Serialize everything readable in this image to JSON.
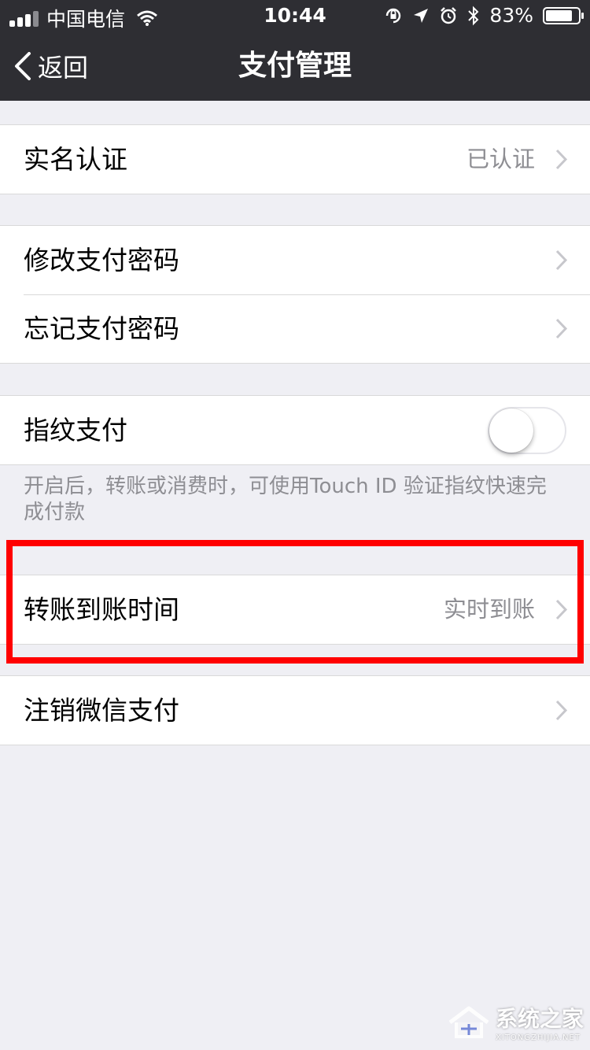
{
  "status_bar": {
    "carrier": "中国电信",
    "time": "10:44",
    "battery": "83%",
    "battery_level": 0.83,
    "icons": [
      "signal-icon",
      "wifi-icon",
      "rotation-lock-icon",
      "location-icon",
      "alarm-icon",
      "bluetooth-icon",
      "battery-icon"
    ]
  },
  "nav": {
    "back_label": "返回",
    "title": "支付管理"
  },
  "sections": {
    "verification": {
      "label": "实名认证",
      "detail": "已认证"
    },
    "change_password": {
      "label": "修改支付密码"
    },
    "forgot_password": {
      "label": "忘记支付密码"
    },
    "fingerprint": {
      "label": "指纹支付",
      "enabled": false
    },
    "fingerprint_note": "开启后，转账或消费时，可使用Touch ID 验证指纹快速完成付款",
    "transfer_time": {
      "label": "转账到账时间",
      "detail": "实时到账"
    },
    "cancel_pay": {
      "label": "注销微信支付"
    }
  },
  "colors": {
    "nav_bg": "#2e2e33",
    "page_bg": "#efeff4",
    "highlight": "#ff0000"
  },
  "watermark": {
    "main": "系统之家",
    "sub": "XITONGZHIJIA.NET"
  }
}
